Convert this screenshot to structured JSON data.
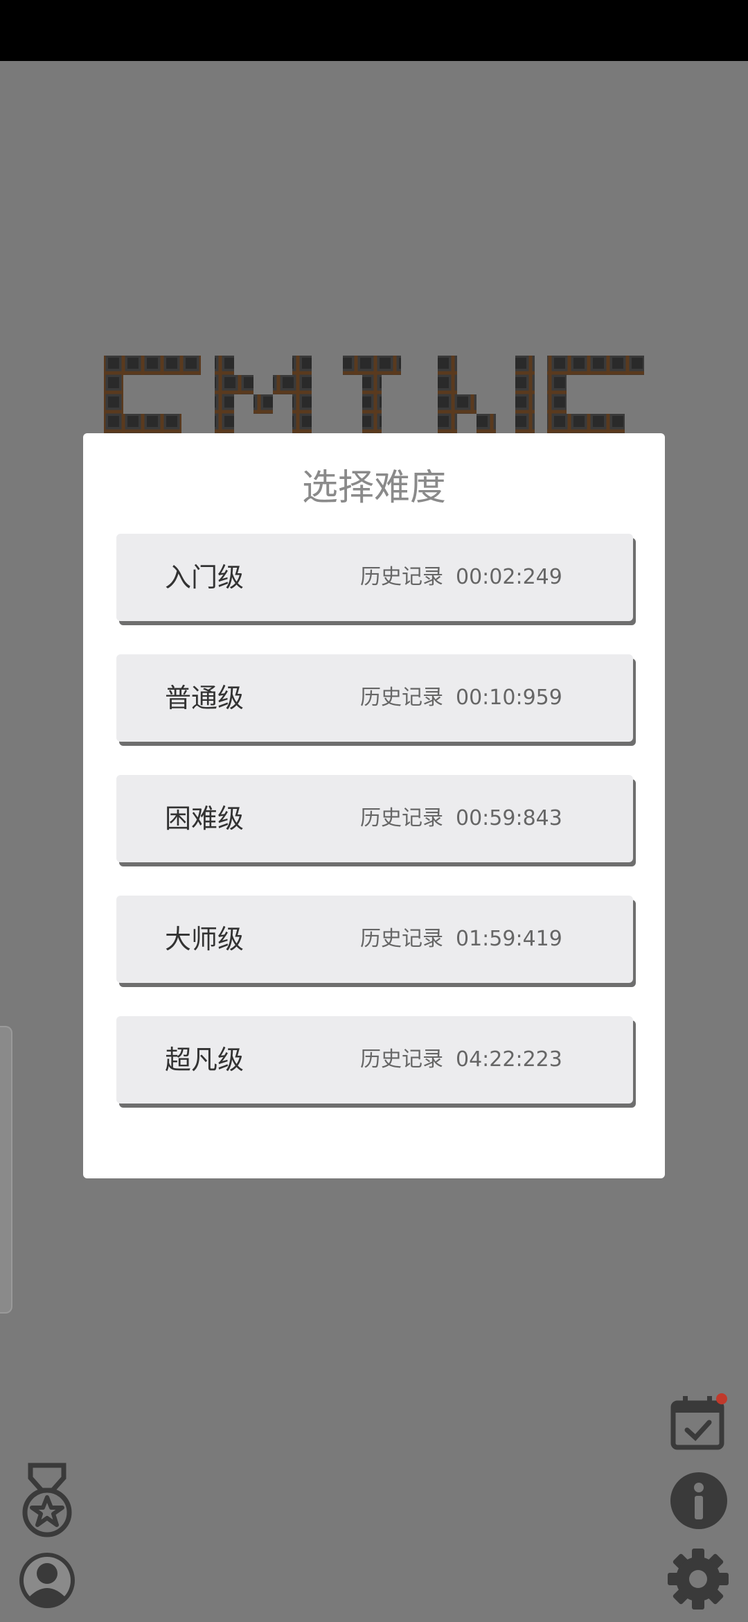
{
  "dialog": {
    "title": "选择难度",
    "record_label": "历史记录",
    "levels": [
      {
        "name": "入门级",
        "record": "00:02:249"
      },
      {
        "name": "普通级",
        "record": "00:10:959"
      },
      {
        "name": "困难级",
        "record": "00:59:843"
      },
      {
        "name": "大师级",
        "record": "01:59:419"
      },
      {
        "name": "超凡级",
        "record": "04:22:223"
      }
    ]
  },
  "icons": {
    "medal": "medal-star-icon",
    "profile": "user-avatar-icon",
    "calendar": "calendar-check-icon",
    "info": "info-icon",
    "settings": "gear-icon"
  },
  "colors": {
    "background": "#7a7a7a",
    "dialog": "#ffffff",
    "card": "#ececee",
    "notification_dot": "#c0392b"
  }
}
